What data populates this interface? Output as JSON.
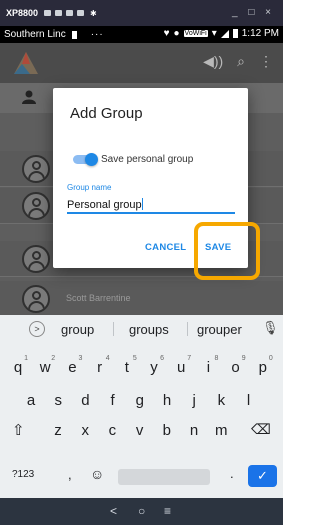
{
  "emulator": {
    "title": "XP8800",
    "window_controls": "_ □ ×"
  },
  "status_bar": {
    "carrier": "Southern Linc",
    "dots": "···",
    "wifi_label": "VoWiFi",
    "time": "1:12 PM"
  },
  "app": {
    "contacts": [
      {
        "name": ""
      },
      {
        "name": ""
      },
      {
        "name": ""
      },
      {
        "name": "Scott Barrentine"
      }
    ]
  },
  "dialog": {
    "title": "Add Group",
    "toggle_label": "Save personal group",
    "toggle_on": true,
    "field_label": "Group name",
    "field_value": "Personal group",
    "cancel_label": "CANCEL",
    "save_label": "SAVE"
  },
  "keyboard": {
    "suggestions": [
      "group",
      "groups",
      "grouper"
    ],
    "row1": [
      {
        "k": "q",
        "n": "1"
      },
      {
        "k": "w",
        "n": "2"
      },
      {
        "k": "e",
        "n": "3"
      },
      {
        "k": "r",
        "n": "4"
      },
      {
        "k": "t",
        "n": "5"
      },
      {
        "k": "y",
        "n": "6"
      },
      {
        "k": "u",
        "n": "7"
      },
      {
        "k": "i",
        "n": "8"
      },
      {
        "k": "o",
        "n": "9"
      },
      {
        "k": "p",
        "n": "0"
      }
    ],
    "row2": [
      "a",
      "s",
      "d",
      "f",
      "g",
      "h",
      "j",
      "k",
      "l"
    ],
    "row3": [
      "z",
      "x",
      "c",
      "v",
      "b",
      "n",
      "m"
    ],
    "symbols_label": "?123",
    "comma_label": ",",
    "period_label": ".",
    "shift_icon": "shift-icon",
    "backspace_icon": "backspace-icon",
    "emoji_icon": "emoji-icon",
    "enter_icon": "checkmark-icon"
  },
  "nav": {
    "back": "<",
    "home": "○",
    "recents": "≡"
  },
  "colors": {
    "accent": "#1e88e5",
    "highlight": "#f6a800",
    "toolbar": "#4b4b4b",
    "nav": "#2c3440"
  }
}
